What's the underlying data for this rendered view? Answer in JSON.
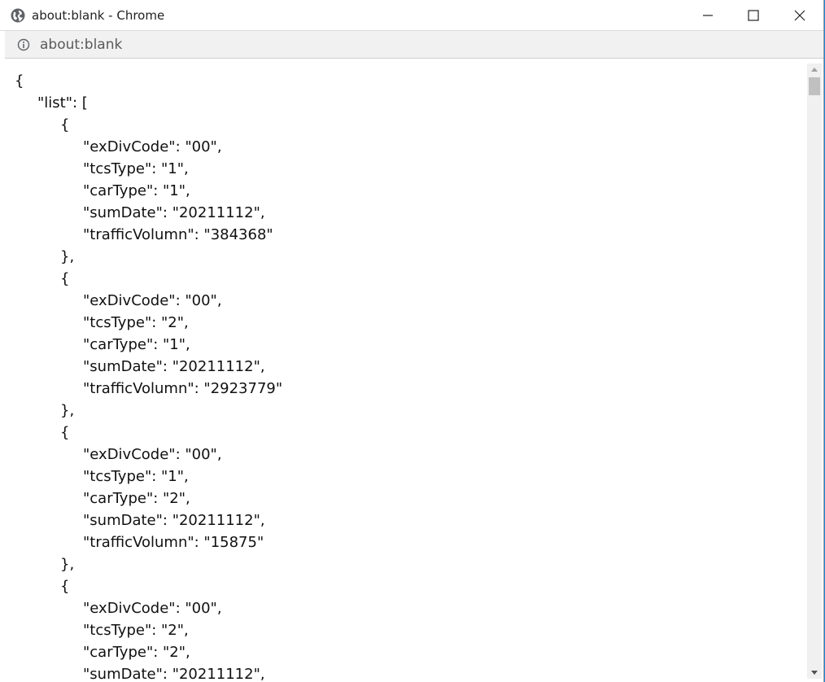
{
  "window": {
    "title": "about:blank - Chrome",
    "icon": "globe-icon"
  },
  "addressbar": {
    "url": "about:blank",
    "icon": "info-icon"
  },
  "content": {
    "lines": [
      {
        "text": "{",
        "indent": 0
      },
      {
        "text": "\"list\": [",
        "indent": 1
      },
      {
        "text": "{",
        "indent": 2
      },
      {
        "text": "\"exDivCode\": \"00\",",
        "indent": 3
      },
      {
        "text": "\"tcsType\": \"1\",",
        "indent": 3
      },
      {
        "text": "\"carType\": \"1\",",
        "indent": 3
      },
      {
        "text": "\"sumDate\": \"20211112\",",
        "indent": 3
      },
      {
        "text": "\"trafficVolumn\": \"384368\"",
        "indent": 3
      },
      {
        "text": "},",
        "indent": 2
      },
      {
        "text": "{",
        "indent": 2
      },
      {
        "text": "\"exDivCode\": \"00\",",
        "indent": 3
      },
      {
        "text": "\"tcsType\": \"2\",",
        "indent": 3
      },
      {
        "text": "\"carType\": \"1\",",
        "indent": 3
      },
      {
        "text": "\"sumDate\": \"20211112\",",
        "indent": 3
      },
      {
        "text": "\"trafficVolumn\": \"2923779\"",
        "indent": 3
      },
      {
        "text": "},",
        "indent": 2
      },
      {
        "text": "{",
        "indent": 2
      },
      {
        "text": "\"exDivCode\": \"00\",",
        "indent": 3
      },
      {
        "text": "\"tcsType\": \"1\",",
        "indent": 3
      },
      {
        "text": "\"carType\": \"2\",",
        "indent": 3
      },
      {
        "text": "\"sumDate\": \"20211112\",",
        "indent": 3
      },
      {
        "text": "\"trafficVolumn\": \"15875\"",
        "indent": 3
      },
      {
        "text": "},",
        "indent": 2
      },
      {
        "text": "{",
        "indent": 2
      },
      {
        "text": "\"exDivCode\": \"00\",",
        "indent": 3
      },
      {
        "text": "\"tcsType\": \"2\",",
        "indent": 3
      },
      {
        "text": "\"carType\": \"2\",",
        "indent": 3
      },
      {
        "text": "\"sumDate\": \"20211112\",",
        "indent": 3
      }
    ]
  },
  "colors": {
    "desktop": "#1e88d8",
    "text": "#111111",
    "addressbar": "#f1f1f1"
  }
}
